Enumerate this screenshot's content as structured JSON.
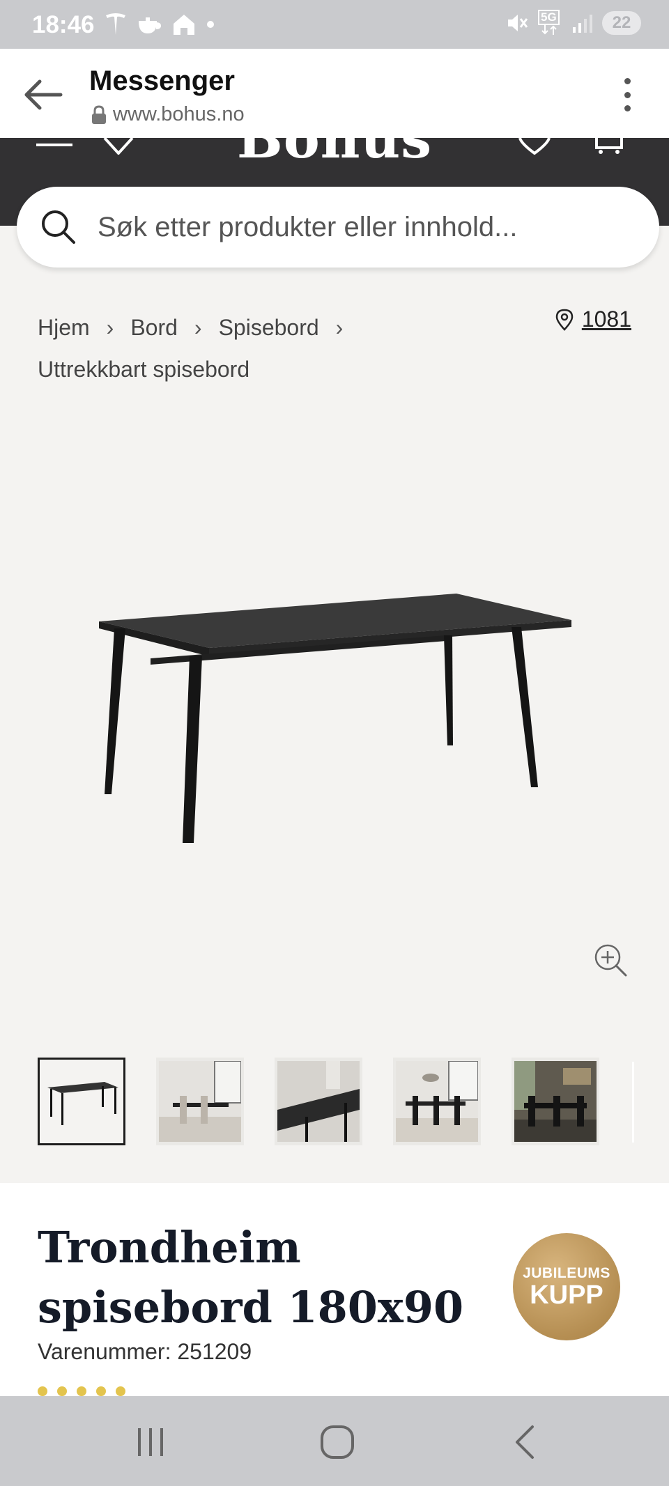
{
  "status_bar": {
    "time": "18:46",
    "battery": "22",
    "network_label": "5G"
  },
  "browser": {
    "app_title": "Messenger",
    "url": "www.bohus.no"
  },
  "site": {
    "logo": "Bohus"
  },
  "search": {
    "placeholder": "Søk etter produkter eller innhold..."
  },
  "breadcrumb": {
    "items": [
      "Hjem",
      "Bord",
      "Spisebord",
      "Uttrekkbart spisebord"
    ],
    "store_number": "1081"
  },
  "product": {
    "title": "Trondheim spisebord 180x90",
    "sku_label": "Varenummer:",
    "sku": "251209",
    "badge_line1": "JUBILEUMS",
    "badge_line2": "KUPP",
    "thumbnail_count": 5
  },
  "colors": {
    "status_bar": "#c9cacd",
    "site_header": "#323133",
    "page_bg": "#f4f3f1",
    "badge_gold": "#c29f66",
    "title_navy": "#151b28"
  }
}
